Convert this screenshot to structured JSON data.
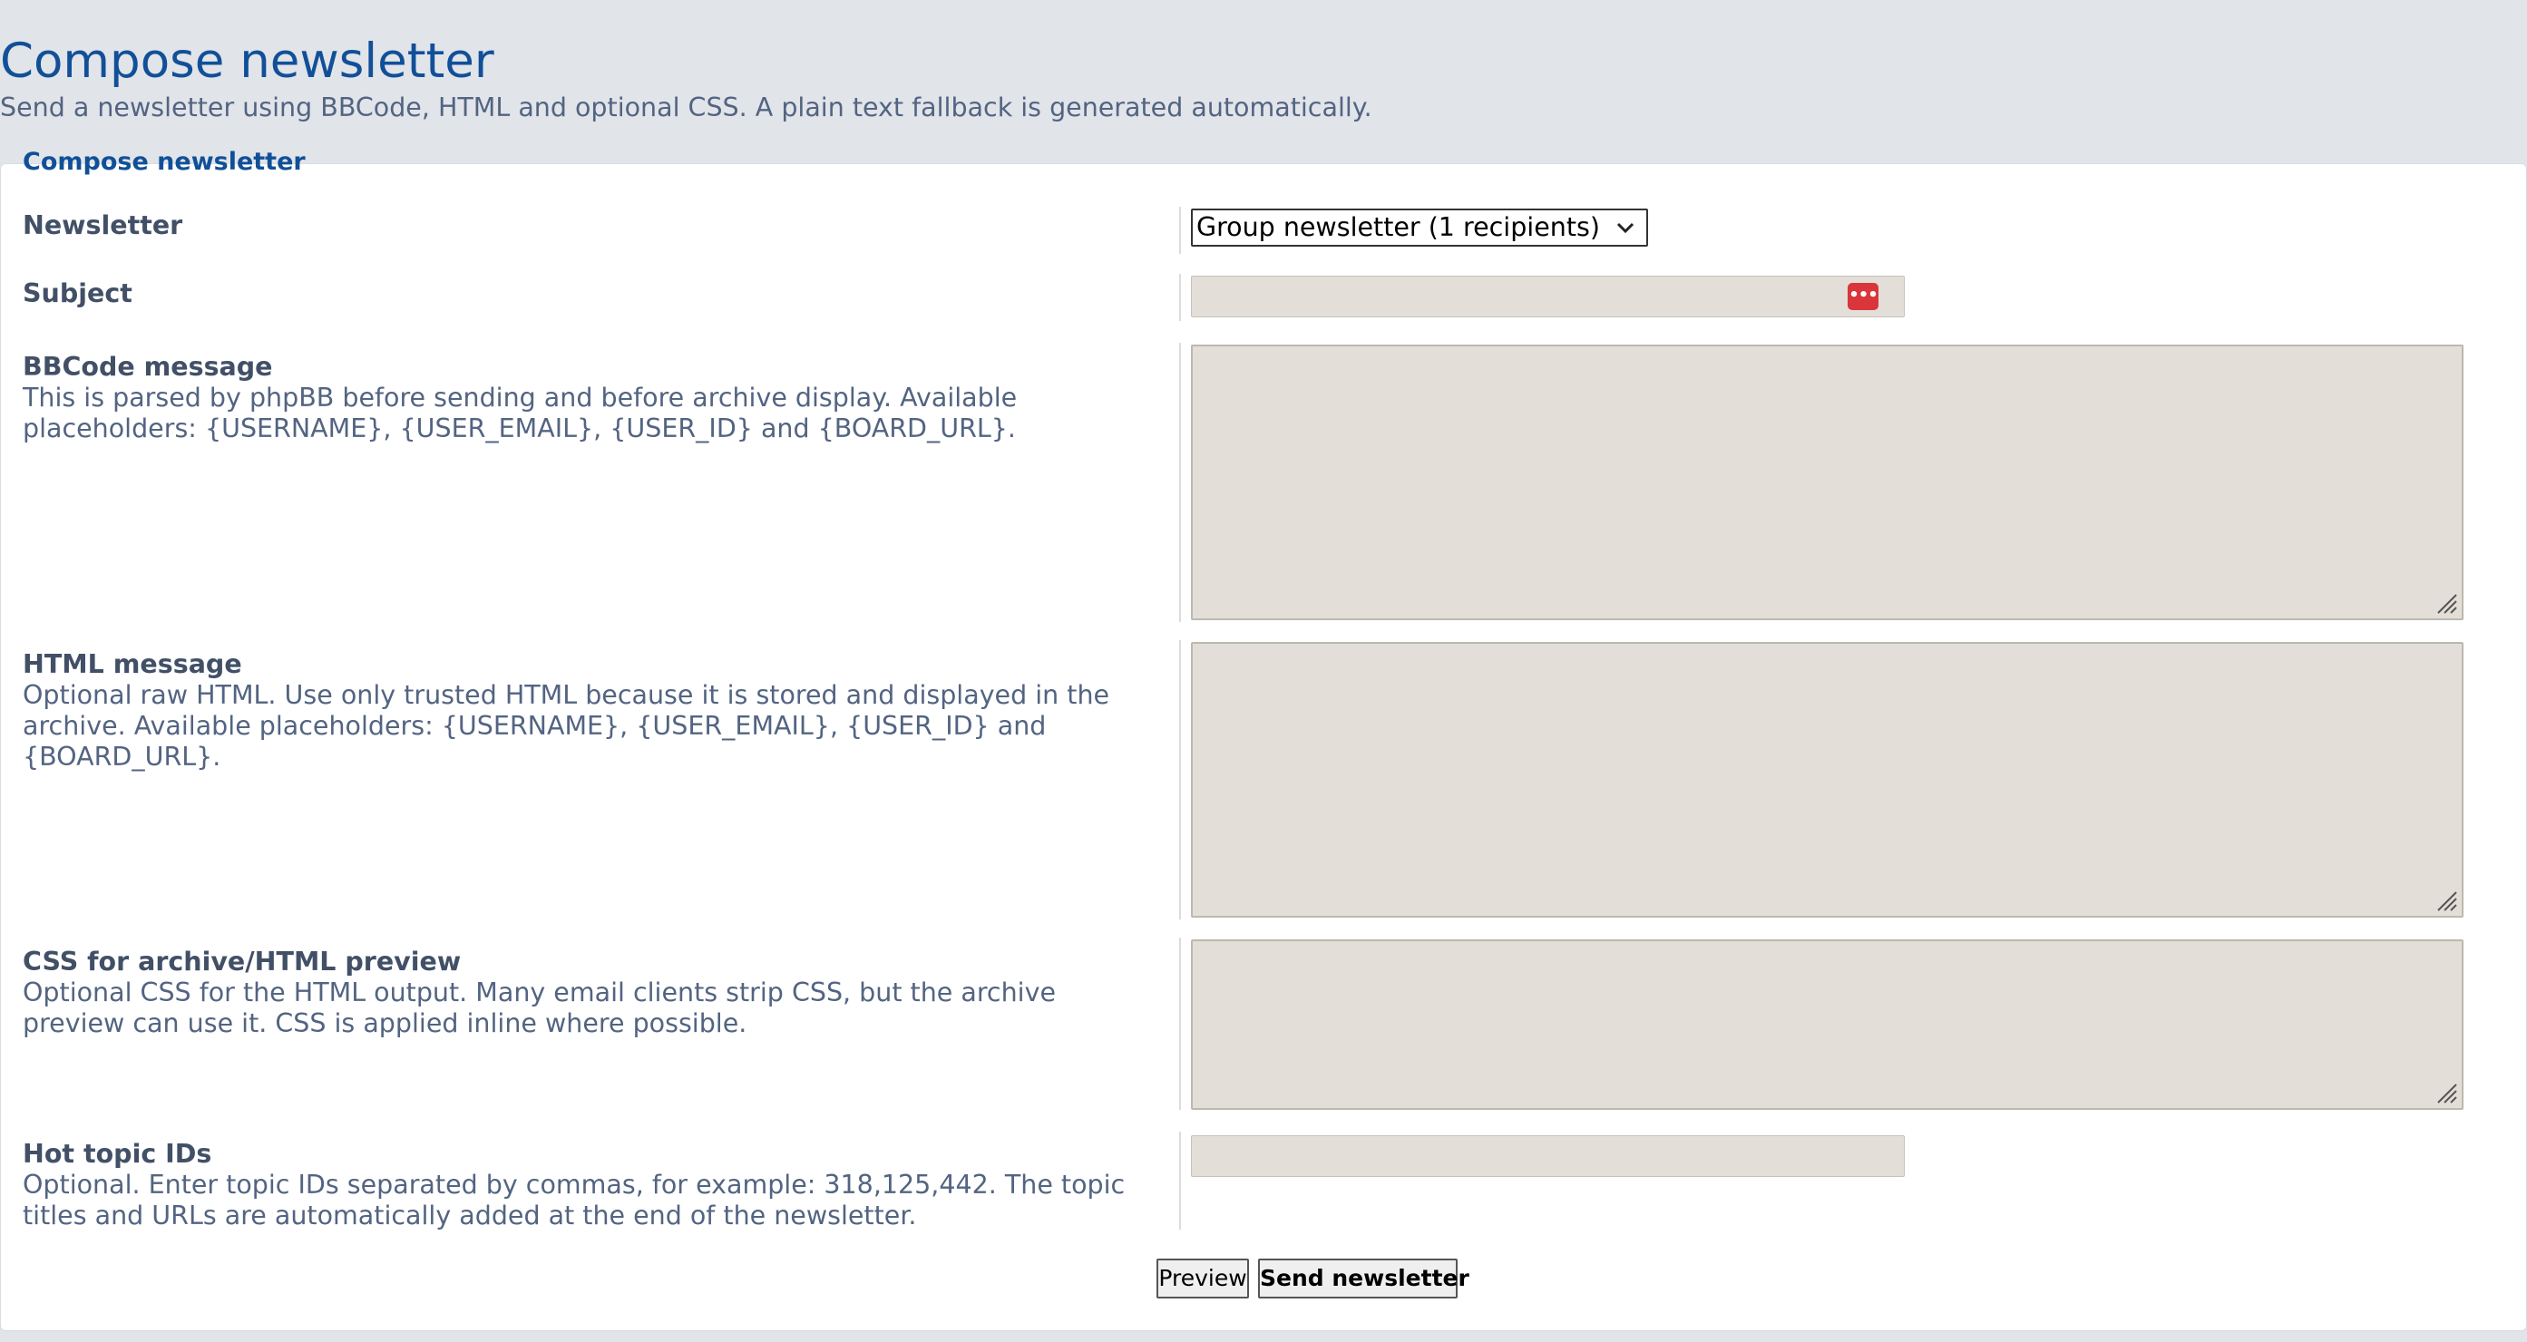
{
  "header": {
    "title": "Compose newsletter",
    "description": "Send a newsletter using BBCode, HTML and optional CSS. A plain text fallback is generated automatically."
  },
  "form": {
    "legend": "Compose newsletter",
    "newsletter": {
      "label": "Newsletter",
      "selected": "Group newsletter (1 recipients)"
    },
    "subject": {
      "label": "Subject",
      "value": ""
    },
    "bbcode": {
      "label": "BBCode message",
      "explain": "This is parsed by phpBB before sending and before archive display. Available placeholders: {USERNAME}, {USER_EMAIL}, {USER_ID} and {BOARD_URL}.",
      "value": ""
    },
    "html": {
      "label": "HTML message",
      "explain": "Optional raw HTML. Use only trusted HTML because it is stored and displayed in the archive. Available placeholders: {USERNAME}, {USER_EMAIL}, {USER_ID} and {BOARD_URL}.",
      "value": ""
    },
    "css": {
      "label": "CSS for archive/HTML preview",
      "explain": "Optional CSS for the HTML output. Many email clients strip CSS, but the archive preview can use it. CSS is applied inline where possible.",
      "value": ""
    },
    "hot_topics": {
      "label": "Hot topic IDs",
      "explain": "Optional. Enter topic IDs separated by commas, for example: 318,125,442. The topic titles and URLs are automatically added at the end of the newsletter.",
      "value": ""
    }
  },
  "buttons": {
    "preview": "Preview",
    "send": "Send newsletter"
  },
  "icons": {
    "password_manager": "password-manager-icon",
    "select_chevron": "chevron-down-icon",
    "resize_grip": "resize-grip-icon"
  },
  "colors": {
    "title": "#115098",
    "text": "#536482",
    "label": "#425067",
    "input_bg": "#e3dfd8",
    "badge": "#d9353b"
  }
}
